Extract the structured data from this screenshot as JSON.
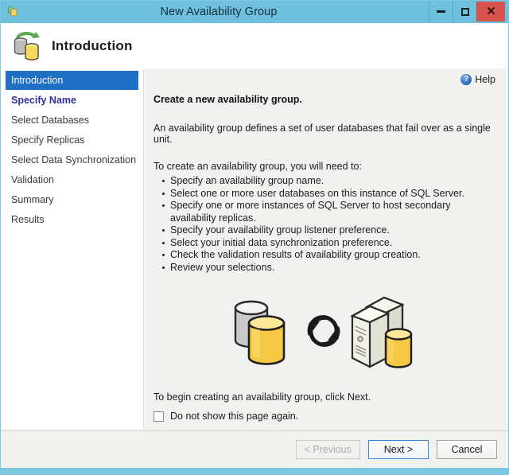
{
  "window": {
    "title": "New Availability Group",
    "app_icon": "database-icon",
    "controls": {
      "minimize": "minimize-icon",
      "maximize": "maximize-icon",
      "close": "close-icon"
    }
  },
  "header": {
    "icon": "availability-group-icon",
    "title": "Introduction"
  },
  "sidebar": {
    "items": [
      {
        "label": "Introduction",
        "state": "active"
      },
      {
        "label": "Specify Name",
        "state": "link"
      },
      {
        "label": "Select Databases",
        "state": "normal"
      },
      {
        "label": "Specify Replicas",
        "state": "normal"
      },
      {
        "label": "Select Data Synchronization",
        "state": "normal"
      },
      {
        "label": "Validation",
        "state": "normal"
      },
      {
        "label": "Summary",
        "state": "normal"
      },
      {
        "label": "Results",
        "state": "normal"
      }
    ]
  },
  "help": {
    "label": "Help",
    "icon": "help-question-icon"
  },
  "main": {
    "lead": "Create a new availability group.",
    "description": "An availability group defines a set of user databases that fail over as a single unit.",
    "steps_intro": "To create an availability group, you will need to:",
    "steps": [
      "Specify an availability group name.",
      "Select one or more user databases on this instance of SQL Server.",
      "Specify one or more instances of SQL Server to host secondary availability replicas.",
      "Specify your availability group listener preference.",
      "Select your initial data synchronization preference.",
      "Check the validation results of availability group creation.",
      "Review your selections."
    ],
    "illustration": "databases-sync-servers-illustration",
    "footer_text": "To begin creating an availability group, click Next.",
    "checkbox": {
      "label": "Do not show this page again.",
      "checked": false
    }
  },
  "buttons": {
    "previous": "< Previous",
    "next": "Next >",
    "cancel": "Cancel"
  },
  "colors": {
    "title_bar": "#6EC0DC",
    "frame": "#7FC6E0",
    "close_button": "#D9534F",
    "nav_active": "#1F6FC4",
    "nav_link": "#2F2F9E",
    "content_bg": "#F1F1EF",
    "default_button_border": "#3C87C9"
  }
}
